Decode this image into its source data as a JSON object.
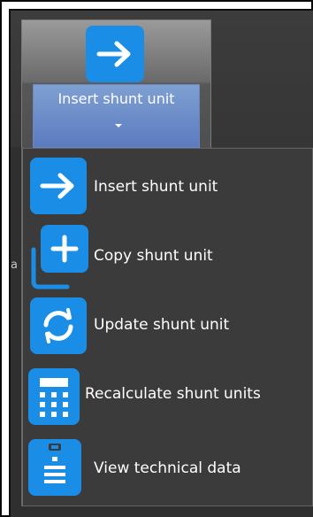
{
  "ribbon": {
    "button_label": "Insert shunt unit",
    "button_icon": "arrow-right-icon",
    "accent_color": "#1a8ee6"
  },
  "left_panel": {
    "visible_char": "a"
  },
  "menu": {
    "items": [
      {
        "label": "Insert shunt unit",
        "icon": "arrow-right-icon"
      },
      {
        "label": "Copy shunt unit",
        "icon": "copy-plus-icon"
      },
      {
        "label": "Update shunt unit",
        "icon": "refresh-icon"
      },
      {
        "label": "Recalculate shunt units",
        "icon": "calculator-icon"
      },
      {
        "label": "View technical data",
        "icon": "clipboard-list-icon"
      }
    ]
  }
}
